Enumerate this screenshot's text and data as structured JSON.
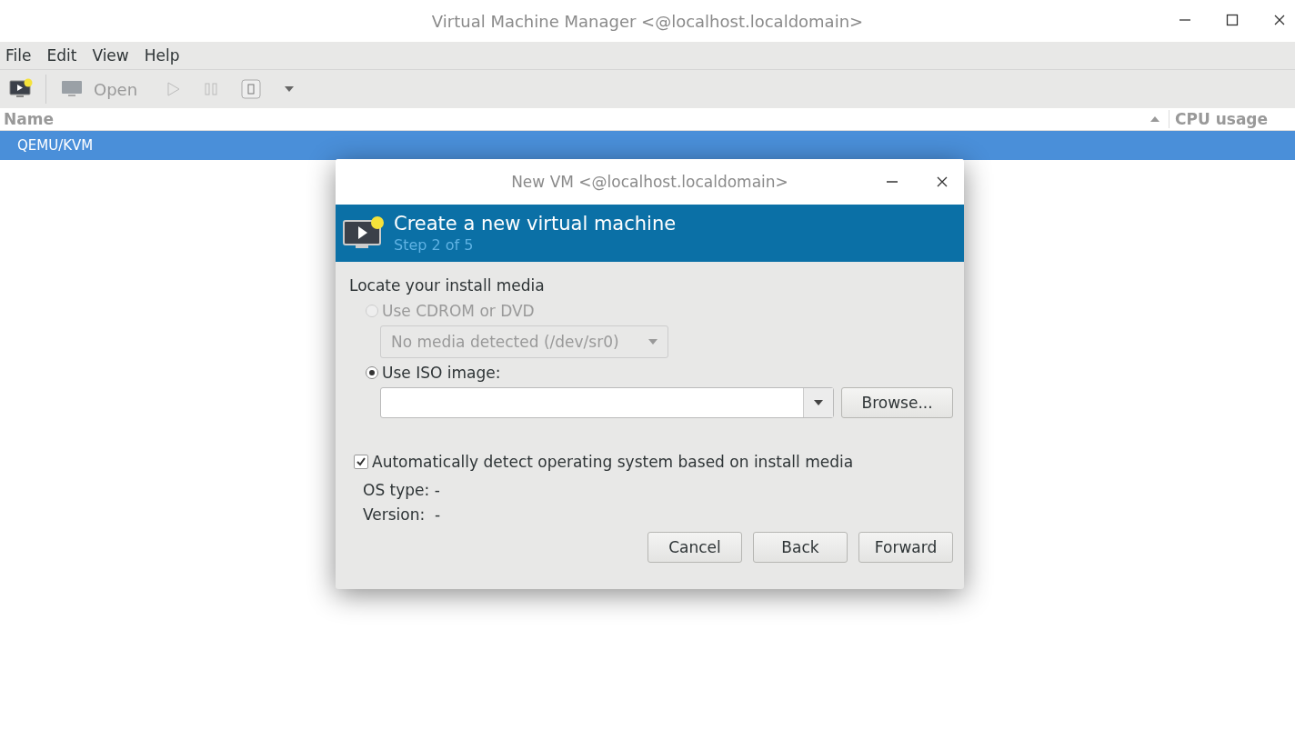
{
  "window": {
    "title": "Virtual Machine Manager <@localhost.localdomain>"
  },
  "menu": [
    "File",
    "Edit",
    "View",
    "Help"
  ],
  "toolbar": {
    "open_label": "Open"
  },
  "table": {
    "columns": [
      "Name",
      "CPU usage"
    ],
    "rows": [
      {
        "name": "QEMU/KVM",
        "selected": true
      }
    ]
  },
  "dialog": {
    "title": "New VM <@localhost.localdomain>",
    "header_title": "Create a new virtual machine",
    "step": "Step 2 of 5",
    "section": "Locate your install media",
    "media_options": [
      {
        "kind": "device",
        "label": "Use CDROM or DVD",
        "selected": false,
        "disabled": true,
        "device": "No media detected (/dev/sr0)"
      },
      {
        "kind": "iso",
        "label": "Use ISO image:",
        "selected": true,
        "disabled": false,
        "button": "Browse..."
      }
    ],
    "autodetect": {
      "label": "Automatically detect operating system based on install media",
      "checked": true
    },
    "details": [
      "OS type: -",
      "Version:  -"
    ],
    "buttons": [
      "Cancel",
      "Back",
      "Forward"
    ]
  }
}
